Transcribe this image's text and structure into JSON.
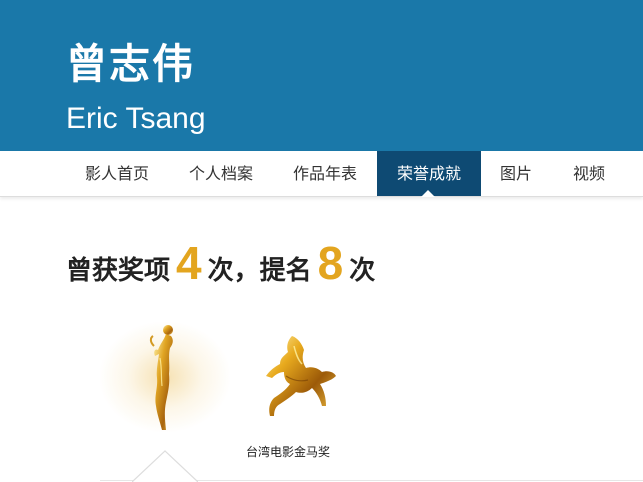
{
  "header": {
    "name_cn": "曾志伟",
    "name_en": "Eric Tsang"
  },
  "nav": {
    "items": [
      {
        "label": "影人首页",
        "active": false
      },
      {
        "label": "个人档案",
        "active": false
      },
      {
        "label": "作品年表",
        "active": false
      },
      {
        "label": "荣誉成就",
        "active": true
      },
      {
        "label": "图片",
        "active": false
      },
      {
        "label": "视频",
        "active": false
      }
    ]
  },
  "awards": {
    "prefix": "曾获奖项",
    "win_count": "4",
    "middle": "次，提名",
    "nomination_count": "8",
    "suffix": "次",
    "trophies": [
      {
        "icon": "statuette-trophy-icon",
        "label": ""
      },
      {
        "icon": "golden-horse-trophy-icon",
        "label": "台湾电影金马奖"
      }
    ]
  },
  "colors": {
    "header_bg": "#1a78a9",
    "nav_active_bg": "#0e4a73",
    "count_accent": "#e3a51f"
  }
}
